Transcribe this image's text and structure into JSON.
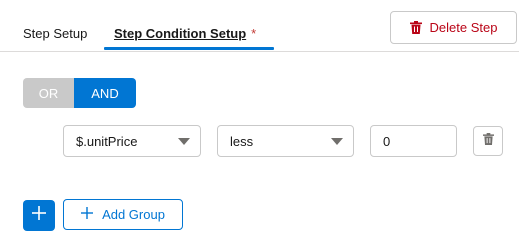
{
  "tabs": {
    "step_setup": "Step Setup",
    "step_condition_setup": "Step Condition Setup",
    "required_marker": "*"
  },
  "actions": {
    "delete_step": "Delete Step",
    "add_group": "Add Group"
  },
  "logic_toggle": {
    "or_label": "OR",
    "and_label": "AND",
    "selected": "AND"
  },
  "condition": {
    "field_value": "$.unitPrice",
    "operator_value": "less",
    "comparison_value": "0"
  },
  "colors": {
    "accent": "#0176d3",
    "danger": "#ba0517",
    "toggle_inactive": "#c9c9c9",
    "border": "#c9c9c9"
  },
  "icons": {
    "delete_step": "trash-icon",
    "condition_delete": "trash-icon",
    "field_dropdown": "caret-down-icon",
    "operator_dropdown": "caret-down-icon",
    "add_condition": "plus-icon",
    "add_group": "plus-icon"
  }
}
